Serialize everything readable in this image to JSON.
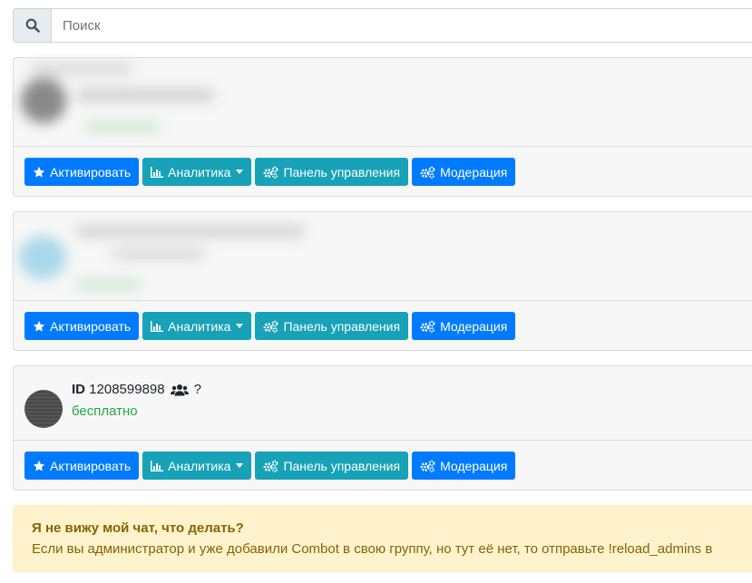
{
  "search": {
    "placeholder": "Поиск"
  },
  "buttons": {
    "activate": "Активировать",
    "analytics": "Аналитика",
    "dashboard": "Панель управления",
    "moderation": "Модерация"
  },
  "chats": [
    {
      "id_label": "ID",
      "id_value": "1208599898",
      "members": "?",
      "plan": "бесплатно"
    }
  ],
  "alert": {
    "title": "Я не вижу мой чат, что делать?",
    "text": "Если вы администратор и уже добавили Combot в свою группу, но тут её нет, то отправьте !reload_admins в"
  },
  "colors": {
    "primary": "#007bff",
    "info": "#17a2b8",
    "success": "#28a745",
    "warning_bg": "#fff3cd"
  }
}
